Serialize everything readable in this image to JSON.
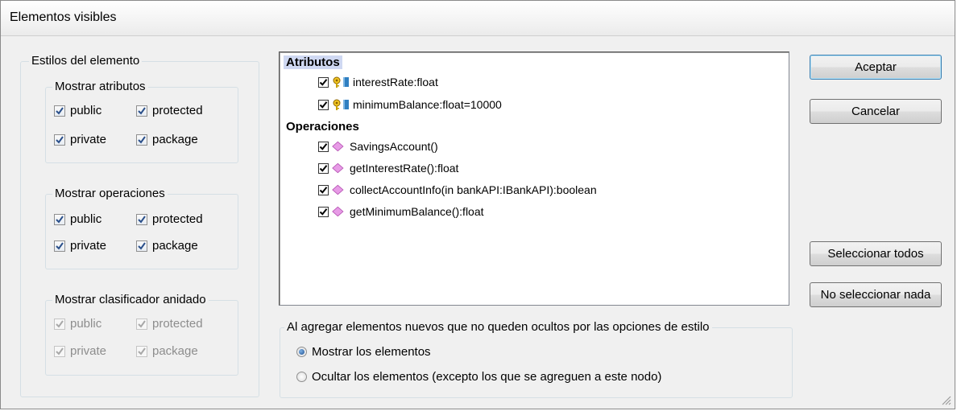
{
  "dialog": {
    "title": "Elementos visibles"
  },
  "element_styles": {
    "legend": "Estilos del elemento",
    "attributes": {
      "legend": "Mostrar atributos",
      "public": {
        "label": "public",
        "checked": true
      },
      "protected": {
        "label": "protected",
        "checked": true
      },
      "private": {
        "label": "private",
        "checked": true
      },
      "package": {
        "label": "package",
        "checked": true
      }
    },
    "operations": {
      "legend": "Mostrar operaciones",
      "public": {
        "label": "public",
        "checked": true
      },
      "protected": {
        "label": "protected",
        "checked": true
      },
      "private": {
        "label": "private",
        "checked": true
      },
      "package": {
        "label": "package",
        "checked": true
      }
    },
    "nested": {
      "legend": "Mostrar clasificador anidado",
      "enabled": false,
      "public": {
        "label": "public",
        "checked": true
      },
      "protected": {
        "label": "protected",
        "checked": true
      },
      "private": {
        "label": "private",
        "checked": true
      },
      "package": {
        "label": "package",
        "checked": true
      }
    }
  },
  "list": {
    "attributes_header": "Atributos",
    "attributes": [
      {
        "label": "interestRate:float",
        "checked": true,
        "icon": "attribute-key-icon"
      },
      {
        "label": "minimumBalance:float=10000",
        "checked": true,
        "icon": "attribute-key-icon"
      }
    ],
    "operations_header": "Operaciones",
    "operations": [
      {
        "label": "SavingsAccount()",
        "checked": true,
        "icon": "operation-diamond-icon"
      },
      {
        "label": "getInterestRate():float",
        "checked": true,
        "icon": "operation-diamond-icon"
      },
      {
        "label": "collectAccountInfo(in bankAPI:IBankAPI):boolean",
        "checked": true,
        "icon": "operation-diamond-icon"
      },
      {
        "label": "getMinimumBalance():float",
        "checked": true,
        "icon": "operation-diamond-icon"
      }
    ]
  },
  "new_elements": {
    "legend": "Al agregar elementos nuevos que no queden ocultos por las opciones de estilo",
    "show": {
      "label": "Mostrar los elementos",
      "selected": true
    },
    "hide": {
      "label": "Ocultar los elementos (excepto los que se agreguen a este nodo)",
      "selected": false
    }
  },
  "buttons": {
    "ok": "Aceptar",
    "cancel": "Cancelar",
    "select_all": "Seleccionar todos",
    "select_none": "No seleccionar nada"
  },
  "colors": {
    "selection_highlight": "#cfd8f2",
    "operation_icon": "#e79be6",
    "attribute_icon": "#c8a000"
  }
}
